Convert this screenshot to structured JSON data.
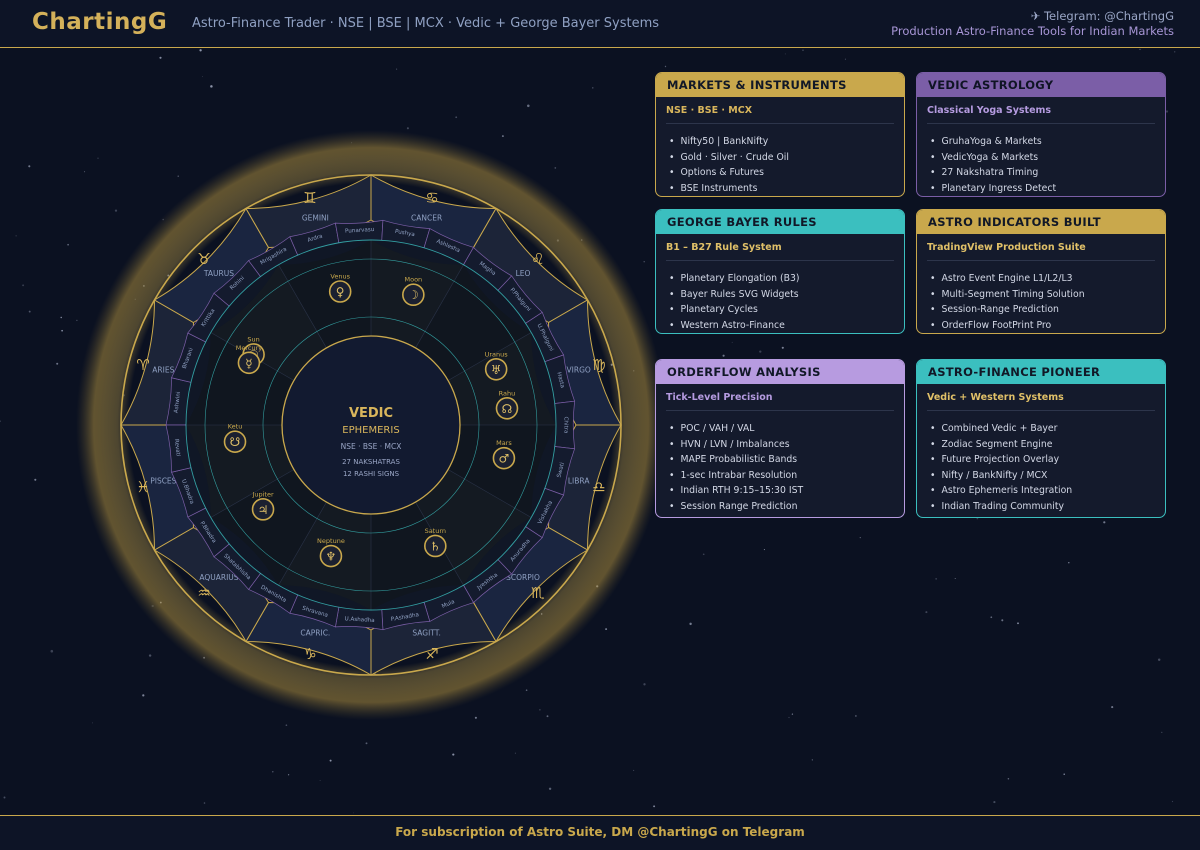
{
  "header": {
    "brand": "ChartingG",
    "tagline": "Astro-Finance Trader  ·  NSE | BSE | MCX  ·  Vedic + George Bayer Systems",
    "telegram": "✈ Telegram: @ChartingG",
    "subtitle": "Production Astro-Finance Tools for Indian Markets"
  },
  "wheel": {
    "center_title": "VEDIC",
    "center_sub": "EPHEMERIS",
    "center_markets": "NSE · BSE · MCX",
    "center_line1": "27 NAKSHATRAS",
    "center_line2": "12 RASHI SIGNS",
    "signs": [
      {
        "name": "ARIES",
        "glyph": "♈"
      },
      {
        "name": "TAURUS",
        "glyph": "♉"
      },
      {
        "name": "GEMINI",
        "glyph": "♊"
      },
      {
        "name": "CANCER",
        "glyph": "♋"
      },
      {
        "name": "LEO",
        "glyph": "♌"
      },
      {
        "name": "VIRGO",
        "glyph": "♍"
      },
      {
        "name": "LIBRA",
        "glyph": "♎"
      },
      {
        "name": "SCORPIO",
        "glyph": "♏"
      },
      {
        "name": "SAGITT.",
        "glyph": "♐"
      },
      {
        "name": "CAPRIC.",
        "glyph": "♑"
      },
      {
        "name": "AQUARIUS",
        "glyph": "♒"
      },
      {
        "name": "PISCES",
        "glyph": "♓"
      }
    ],
    "nakshatras": [
      "Ashwini",
      "Bharani",
      "Krittika",
      "Rohini",
      "Mrigashira",
      "Ardra",
      "Punarvasu",
      "Pushya",
      "Ashlesha",
      "Magha",
      "P.Phalguni",
      "U.Phalguni",
      "Hasta",
      "Chitra",
      "Swati",
      "Vishakha",
      "Anuradha",
      "Jyeshtha",
      "Mula",
      "P.Ashadha",
      "U.Ashadha",
      "Shravana",
      "Dhanishta",
      "Shatabhisha",
      "P.Bhadra",
      "U.Bhadra",
      "Revati"
    ],
    "planets": [
      {
        "name": "Sun",
        "glyph": "☉",
        "lon": 31
      },
      {
        "name": "Moon",
        "glyph": "☽",
        "lon": 108
      },
      {
        "name": "Mercury",
        "glyph": "☿",
        "lon": 27
      },
      {
        "name": "Venus",
        "glyph": "♀",
        "lon": 77
      },
      {
        "name": "Mars",
        "glyph": "♂",
        "lon": 194
      },
      {
        "name": "Jupiter",
        "glyph": "♃",
        "lon": 322
      },
      {
        "name": "Saturn",
        "glyph": "♄",
        "lon": 242
      },
      {
        "name": "Rahu",
        "glyph": "☊",
        "lon": 173
      },
      {
        "name": "Ketu",
        "glyph": "☋",
        "lon": 353
      },
      {
        "name": "Uranus",
        "glyph": "♅",
        "lon": 156
      },
      {
        "name": "Neptune",
        "glyph": "♆",
        "lon": 287
      }
    ]
  },
  "cards": [
    {
      "title": "MARKETS & INSTRUMENTS",
      "subtitle": "NSE · BSE · MCX",
      "color": "#c9a84c",
      "sub_color": "#d9b65c",
      "items": [
        "Nifty50  |  BankNifty",
        "Gold · Silver · Crude Oil",
        "Options & Futures",
        "BSE Instruments"
      ]
    },
    {
      "title": "VEDIC ASTROLOGY",
      "subtitle": "Classical Yoga Systems",
      "color": "#7b5ea7",
      "sub_color": "#b59be0",
      "items": [
        "GruhaYoga & Markets",
        "VedicYoga & Markets",
        "27 Nakshatra Timing",
        "Planetary Ingress Detect"
      ]
    },
    {
      "title": "GEORGE BAYER RULES",
      "subtitle": "B1 – B27 Rule System",
      "color": "#3bbfbf",
      "sub_color": "#e0c068",
      "items": [
        "Planetary Elongation (B3)",
        "Bayer Rules SVG Widgets",
        "Planetary Cycles",
        "Western Astro-Finance"
      ]
    },
    {
      "title": "ASTRO INDICATORS BUILT",
      "subtitle": "TradingView Production Suite",
      "color": "#c9a84c",
      "sub_color": "#e0c068",
      "items": [
        "Astro Event Engine L1/L2/L3",
        "Multi-Segment Timing Solution",
        "Session-Range Prediction",
        "OrderFlow FootPrint Pro"
      ]
    },
    {
      "title": "ORDERFLOW ANALYSIS",
      "subtitle": "Tick-Level Precision",
      "color": "#b79be0",
      "sub_color": "#b59be0",
      "items": [
        "POC / VAH / VAL",
        "HVN / LVN / Imbalances",
        "MAPE Probabilistic Bands",
        "1-sec Intrabar Resolution",
        "Indian RTH 9:15–15:30 IST",
        "Session Range Prediction"
      ]
    },
    {
      "title": "ASTRO-FINANCE PIONEER",
      "subtitle": "Vedic + Western Systems",
      "color": "#3bbfbf",
      "sub_color": "#e0c068",
      "items": [
        "Combined Vedic + Bayer",
        "Zodiac Segment Engine",
        "Future Projection Overlay",
        "Nifty / BankNifty / MCX",
        "Astro Ephemeris Integration",
        "Indian Trading Community"
      ]
    }
  ],
  "footer": {
    "text": "For subscription of Astro Suite,  DM  @ChartingG  on Telegram"
  }
}
